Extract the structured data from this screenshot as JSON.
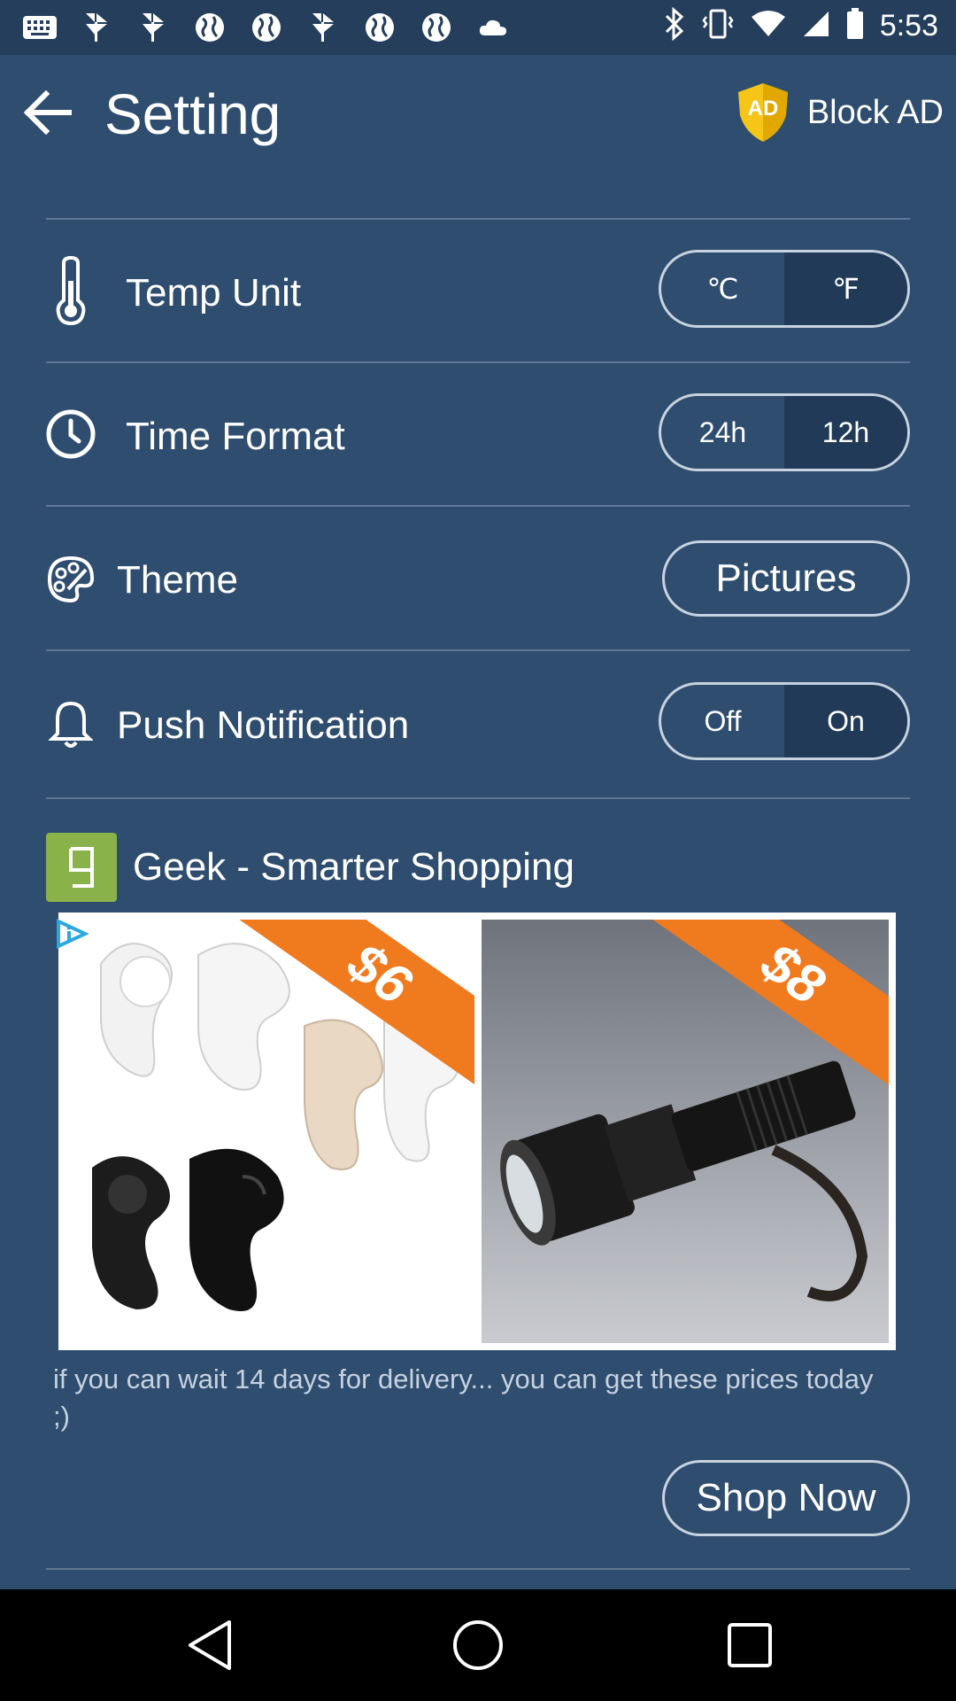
{
  "status_bar": {
    "time": "5:53",
    "left_icons": [
      "keyboard-icon",
      "pinwheel-icon",
      "pinwheel-icon",
      "globe-icon",
      "globe-icon",
      "pinwheel-icon",
      "globe-icon",
      "globe-icon",
      "cloud-icon"
    ],
    "right_icons": [
      "bluetooth-icon",
      "vibrate-icon",
      "wifi-icon",
      "signal-icon",
      "battery-icon"
    ]
  },
  "header": {
    "title": "Setting",
    "block_ad_label": "Block AD",
    "block_ad_badge": "AD"
  },
  "settings": {
    "temp_unit": {
      "label": "Temp Unit",
      "options": [
        "℃",
        "℉"
      ],
      "selected": "℉"
    },
    "time_format": {
      "label": "Time Format",
      "options": [
        "24h",
        "12h"
      ],
      "selected": "12h"
    },
    "theme": {
      "label": "Theme",
      "value": "Pictures"
    },
    "push_notification": {
      "label": "Push Notification",
      "options": [
        "Off",
        "On"
      ],
      "selected": "On"
    }
  },
  "ad": {
    "title": "Geek - Smarter Shopping",
    "price_left": "$6",
    "price_right": "$8",
    "description": "if you can wait 14 days for delivery...  you can get these prices today ;)",
    "cta_label": "Shop Now"
  },
  "colors": {
    "background": "#2f4d6f",
    "segment_active": "#213a58",
    "ad_logo": "#8ab24a",
    "ribbon": "#f07a1e",
    "shield": "#f5c518"
  }
}
